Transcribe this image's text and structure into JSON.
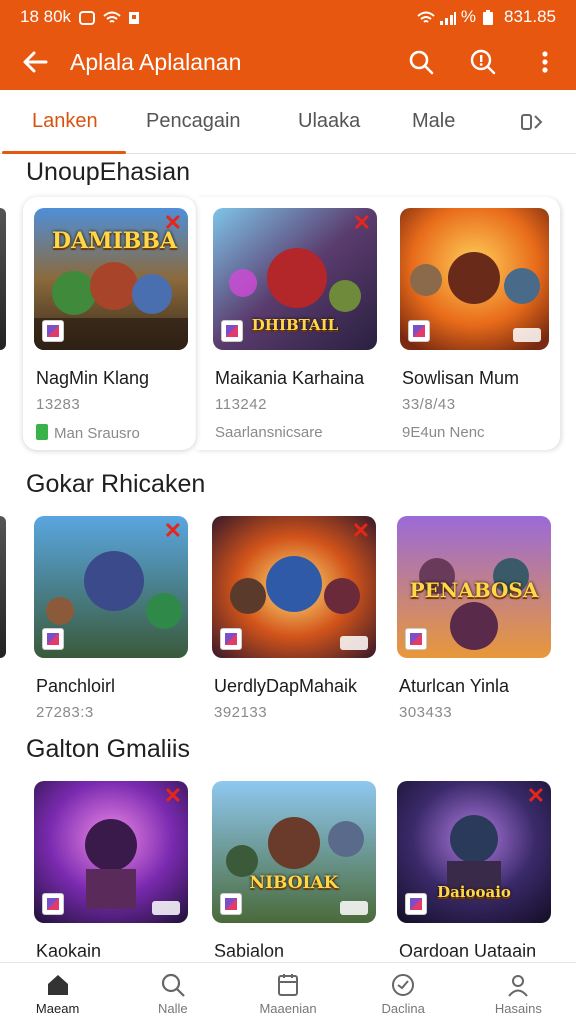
{
  "status_bar": {
    "time": "18 80k",
    "right_text": "%",
    "clock": "831.85"
  },
  "app_bar": {
    "title": "Aplala Aplalanan"
  },
  "tabs": [
    {
      "label": "Lanken",
      "active": true
    },
    {
      "label": "Pencagain",
      "active": false
    },
    {
      "label": "Ulaaka",
      "active": false
    },
    {
      "label": "Male",
      "active": false
    }
  ],
  "sections": [
    {
      "title": "UnoupEhasian",
      "items": [
        {
          "name": "NagMin Klang",
          "meta": "13283",
          "sub": "Man Srausro",
          "banner": "DAMIBBA"
        },
        {
          "name": "Maikania Karhaina",
          "meta": "113242",
          "sub": "Saarlansnicsare",
          "banner": "DHIBTAIL"
        },
        {
          "name": "Sowlisan Mum",
          "meta": "33/8/43",
          "sub": "9E4un Nenc",
          "banner": ""
        }
      ]
    },
    {
      "title": "Gokar Rhicaken",
      "items": [
        {
          "name": "Panchloirl",
          "meta": "27283:3",
          "banner": ""
        },
        {
          "name": "UerdlyDapMahaik",
          "meta": "392133",
          "banner": ""
        },
        {
          "name": "Aturlcan Yinla",
          "meta": "303433",
          "banner": "PENABOSA"
        }
      ]
    },
    {
      "title": "Galton Gmaliis",
      "items": [
        {
          "name": "Kaokain",
          "banner": ""
        },
        {
          "name": "Sabialon",
          "banner": "NIBOIAK"
        },
        {
          "name": "Oardoan Uataain",
          "banner": "Daiooaio"
        }
      ]
    }
  ],
  "bottom_nav": [
    {
      "label": "Maeam",
      "icon": "home-icon",
      "active": true
    },
    {
      "label": "Nalle",
      "icon": "search-icon",
      "active": false
    },
    {
      "label": "Maaenian",
      "icon": "calendar-icon",
      "active": false
    },
    {
      "label": "Daclina",
      "icon": "clock-icon",
      "active": false
    },
    {
      "label": "Hasains",
      "icon": "profile-icon",
      "active": false
    }
  ],
  "colors": {
    "accent": "#e8570f",
    "close_mark": "#e5261b"
  }
}
